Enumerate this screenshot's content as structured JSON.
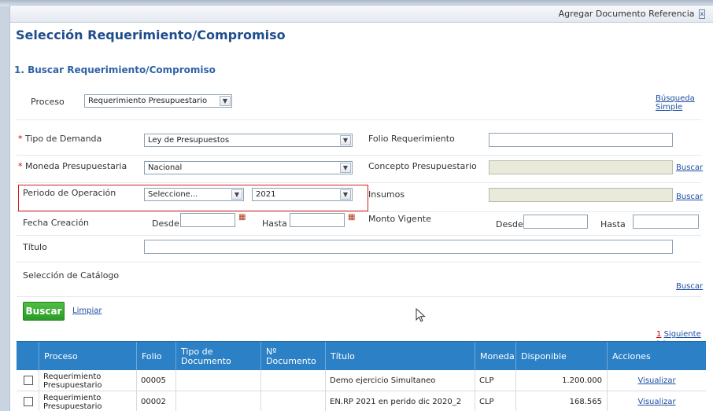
{
  "window": {
    "title": "Agregar Documento Referencia",
    "close_glyph": "x"
  },
  "page": {
    "heading": "Selección Requerimiento/Compromiso",
    "section": "1. Buscar Requerimiento/Compromiso"
  },
  "form": {
    "proceso_label": "Proceso",
    "proceso_value": "Requerimiento Presupuestario",
    "busqueda_simple": "Búsqueda Simple",
    "tipo_demanda_label": "Tipo de Demanda",
    "tipo_demanda_value": "Ley de Presupuestos",
    "folio_label": "Folio Requerimiento",
    "folio_value": "",
    "moneda_label": "Moneda Presupuestaria",
    "moneda_value": "Nacional",
    "concepto_label": "Concepto Presupuestario",
    "periodo_label": "Periodo de Operación",
    "periodo_mes_value": "Seleccione...",
    "periodo_anio_value": "2021",
    "insumos_label": "Insumos",
    "buscar_link": "Buscar",
    "fecha_label": "Fecha Creación",
    "desde_label": "Desde",
    "hasta_label": "Hasta",
    "monto_label": "Monto Vigente",
    "titulo_label": "Título",
    "catalogo_label": "Selección de Catálogo",
    "required_mark": "*"
  },
  "actions": {
    "buscar_button": "Buscar",
    "limpiar_link": "Limpiar"
  },
  "pagination": {
    "page_number": "1",
    "next_label": "Siguiente >>"
  },
  "table": {
    "headers": [
      "Proceso",
      "Folio",
      "Tipo de Documento",
      "Nº Documento",
      "Título",
      "Moneda",
      "Disponible",
      "Acciones"
    ],
    "rows": [
      {
        "proceso": "Requerimiento Presupuestario",
        "folio": "00005",
        "tipo_documento": "",
        "numero_documento": "",
        "titulo": "Demo ejercicio Simultaneo",
        "moneda": "CLP",
        "disponible": "1.200.000",
        "accion": "Visualizar"
      },
      {
        "proceso": "Requerimiento Presupuestario",
        "folio": "00002",
        "tipo_documento": "",
        "numero_documento": "",
        "titulo": "EN.RP 2021 en perido dic 2020_2",
        "moneda": "CLP",
        "disponible": "168.565",
        "accion": "Visualizar"
      }
    ]
  },
  "colors": {
    "heading": "#1f4d8c",
    "table_header": "#2c80c5",
    "highlight_border": "#d61f1f",
    "button_green": "#2b9a28"
  }
}
